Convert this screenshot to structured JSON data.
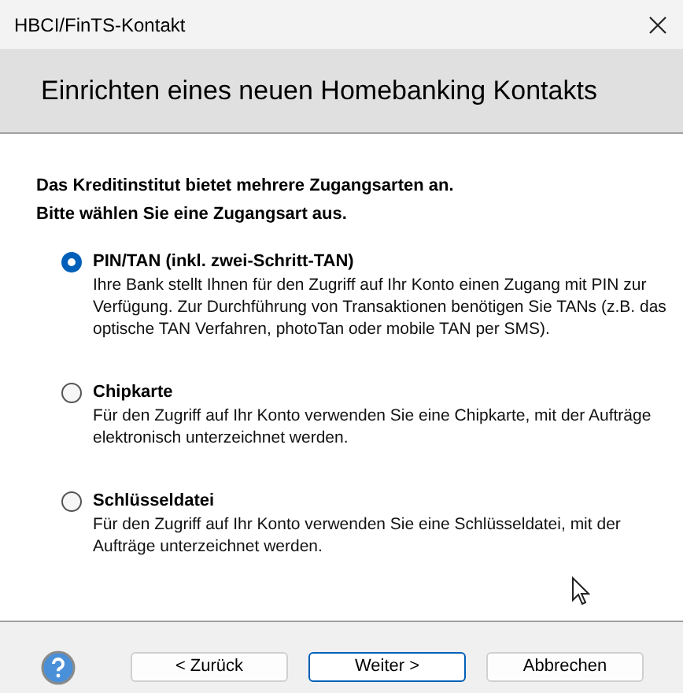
{
  "window": {
    "title": "HBCI/FinTS-Kontakt"
  },
  "header": {
    "title": "Einrichten eines neuen Homebanking Kontakts"
  },
  "intro": [
    "Das Kreditinstitut bietet mehrere Zugangsarten an.",
    "Bitte wählen Sie eine Zugangsart aus."
  ],
  "options": [
    {
      "label": "PIN/TAN (inkl. zwei-Schritt-TAN)",
      "selected": true,
      "description": "Ihre Bank stellt Ihnen für den Zugriff auf Ihr Konto einen Zugang mit PIN zur Verfügung. Zur Durchführung von Transaktionen benötigen Sie TANs (z.B. das optische TAN Verfahren, photoTan oder mobile TAN per SMS)."
    },
    {
      "label": "Chipkarte",
      "selected": false,
      "description": "Für den Zugriff auf Ihr Konto verwenden Sie eine Chipkarte, mit der Aufträge elektronisch unterzeichnet werden."
    },
    {
      "label": "Schlüsseldatei",
      "selected": false,
      "description": "Für den Zugriff auf Ihr Konto verwenden Sie eine Schlüsseldatei, mit der Aufträge unterzeichnet werden."
    }
  ],
  "buttons": [
    {
      "label": "< Zurück",
      "focused": false
    },
    {
      "label": "Weiter >",
      "focused": true
    },
    {
      "label": "Abbrechen",
      "focused": false
    }
  ]
}
